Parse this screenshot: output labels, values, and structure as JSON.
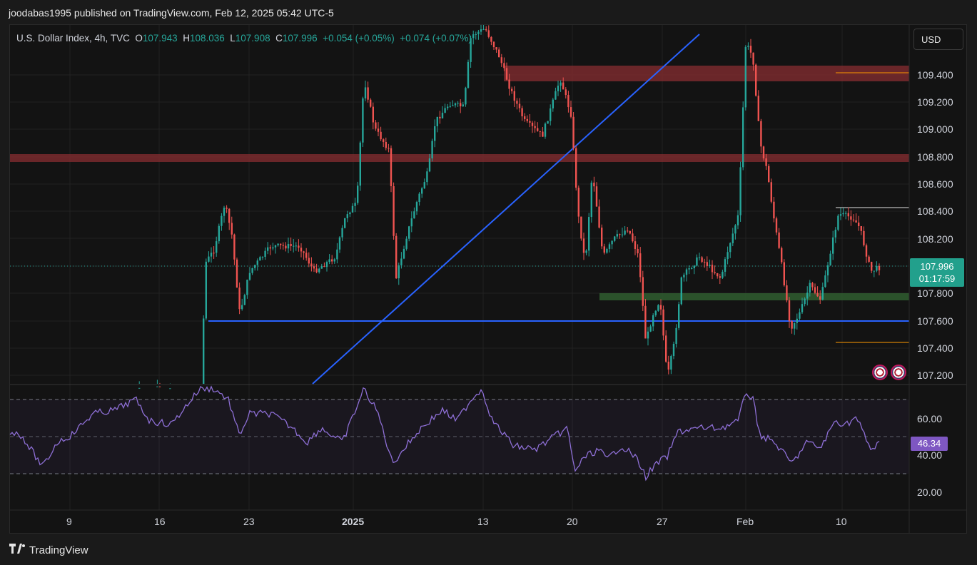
{
  "header": {
    "publish_text": "joodabas1995 published on TradingView.com, Feb 12, 2025 05:42 UTC-5"
  },
  "legend": {
    "symbol": "U.S. Dollar Index, 4h, TVC",
    "o_label": "O",
    "o_value": "107.943",
    "h_label": "H",
    "h_value": "108.036",
    "l_label": "L",
    "l_value": "107.908",
    "c_label": "C",
    "c_value": "107.996",
    "change": "+0.054 (+0.05%)",
    "change2": "+0.074 (+0.07%)"
  },
  "currency": "USD",
  "price_axis": [
    "109.400",
    "109.200",
    "109.000",
    "108.800",
    "108.600",
    "108.400",
    "108.200",
    "107.800",
    "107.600",
    "107.400",
    "107.200"
  ],
  "rsi_axis": [
    "60.00",
    "40.00",
    "20.00"
  ],
  "time_axis": [
    "9",
    "16",
    "23",
    "2025",
    "13",
    "20",
    "27",
    "Feb",
    "10"
  ],
  "last_price": {
    "price": "107.996",
    "countdown": "01:17:59"
  },
  "rsi_value": "46.34",
  "footer": {
    "brand": "TradingView"
  },
  "colors": {
    "up": "#26a69a",
    "down": "#ef5350",
    "rsi": "#7e57c2",
    "trendline": "#2962ff",
    "resistance": "#8b2a2a",
    "support": "#2e5e2e"
  },
  "icons": [
    "us-flag-icon",
    "tradingview-logo-icon"
  ]
}
